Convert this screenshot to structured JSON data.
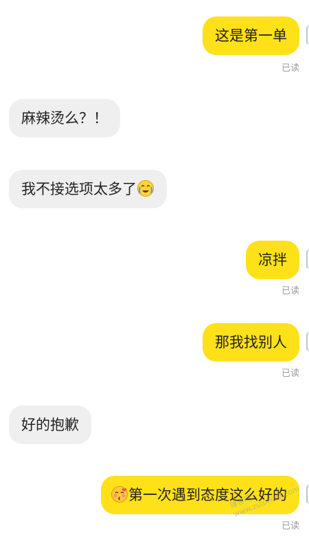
{
  "messages": [
    {
      "dir": "out",
      "text": "这是第一单",
      "status": "已读"
    },
    {
      "dir": "in",
      "text": "麻辣烫么？！"
    },
    {
      "dir": "in",
      "text": "我不接选项太多了",
      "emoji": "crying-face-icon"
    },
    {
      "dir": "out",
      "text": "凉拌",
      "status": "已读"
    },
    {
      "dir": "out",
      "text": "那我找别人",
      "status": "已读"
    },
    {
      "dir": "in",
      "text": "好的抱歉"
    },
    {
      "dir": "out",
      "text": "第一次遇到态度这么好的",
      "emoji_before": "kissing-face-icon",
      "status": "已读"
    }
  ],
  "watermark": {
    "line1": "赚客吧",
    "line2": "www.zuanke8.com"
  },
  "colors": {
    "outgoing_bubble": "#ffe11a",
    "incoming_bubble": "#efefef",
    "read_status": "#9b9b9b"
  }
}
